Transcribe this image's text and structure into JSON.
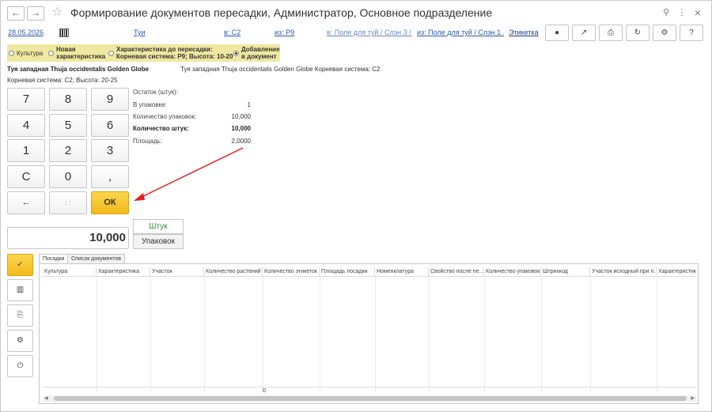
{
  "title": "Формирование документов пересадки, Администратор, Основное подразделение",
  "icons": {
    "back": "←",
    "forward": "→",
    "star": "☆",
    "link": "⚲",
    "more": "⋮",
    "close": "×",
    "user": "●",
    "arrow_up_right": "↗",
    "print": "⎙",
    "refresh": "↻",
    "gear": "⚙",
    "help": "?"
  },
  "toolbar": {
    "date": "28.05.2026",
    "link_tui": "Туи",
    "link_to": "в: С2",
    "link_from": "из: Р9",
    "link_field_to": "в: Поле для туй / Слэн 3 /...",
    "link_field_from": "из: Поле для туй / Слэн 1 ...",
    "link_label": "Этикетка"
  },
  "radios": [
    {
      "label": "Культура",
      "selected": false
    },
    {
      "label": "Новая характеристика",
      "selected": false
    },
    {
      "label": "Характеристика до пересадки: Корневая система: Р9; Высота: 10-20",
      "selected": false
    },
    {
      "label": "Добавление в документ",
      "selected": true
    }
  ],
  "item": {
    "name": "Туя западная Thuja occidentalis Golden Globe",
    "characteristic": "Корневая система: С2; Высота: 20-25",
    "name_right": "Туя западная Thuja occidentalis Golden Globe  Корневая система: С2"
  },
  "keypad": {
    "k7": "7",
    "k8": "8",
    "k9": "9",
    "k4": "4",
    "k5": "5",
    "k6": "6",
    "k1": "1",
    "k2": "2",
    "k3": "3",
    "kc": "С",
    "k0": "0",
    "kcomma": ",",
    "kback": "←",
    "kmid": "↓↑",
    "kok": "ОК"
  },
  "stats": {
    "balance_label": "Остаток (штук):",
    "per_pack_label": "В упаковке:",
    "per_pack_value": "1",
    "packs_label": "Количество упаковок:",
    "packs_value": "10,000",
    "pieces_label": "Количество штук:",
    "pieces_value": "10,000",
    "area_label": "Площадь:",
    "area_value": "2,0000"
  },
  "quantity": "10,000",
  "units": {
    "pieces": "Штук",
    "packs": "Упаковок"
  },
  "side_icons": {
    "check": "✓",
    "barcode": "▥",
    "doc": "⎘",
    "settings": "⚙",
    "power": "⏻"
  },
  "tabs": [
    "Посадки",
    "Список документов"
  ],
  "grid": {
    "columns": [
      "Культура",
      "Характеристика",
      "Участок",
      "Количество растений",
      "Количество этикеток",
      "Площадь посадки",
      "Номенклатура",
      "Свойство после пе...",
      "Количество упаковок",
      "Штрихкод",
      "Участок исходный при п...",
      "Характеристика"
    ],
    "total": "0"
  },
  "colors": {
    "accent_yellow": "#f3b91c",
    "radio_bg": "#f0e8a0",
    "link": "#2e5aa8",
    "green": "#2f8a3a",
    "arrow": "#e02020"
  }
}
